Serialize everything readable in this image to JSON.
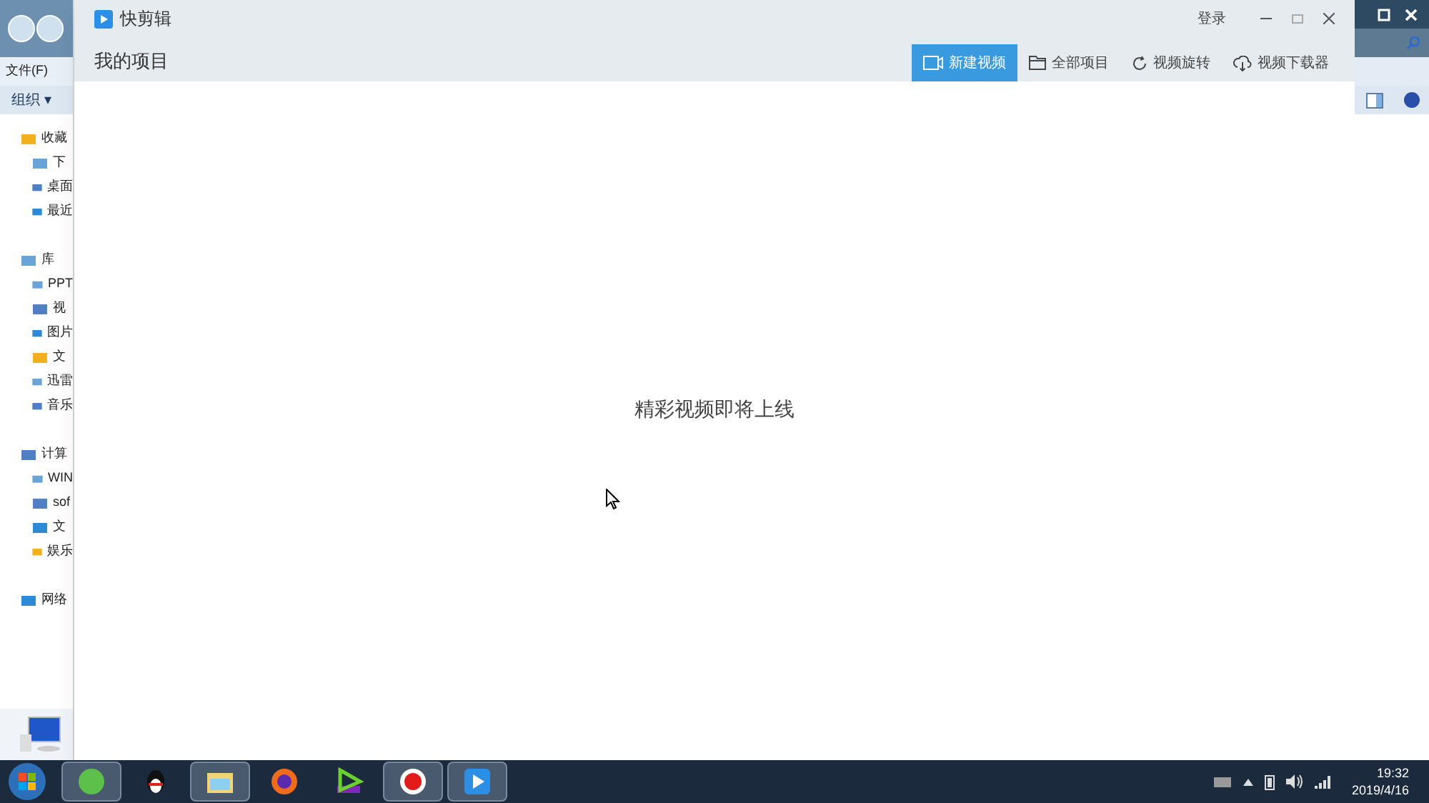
{
  "explorer": {
    "menu": "文件(F)",
    "toolbar": "组织 ▾",
    "tree": [
      {
        "label": "收藏",
        "children": [
          {
            "label": "下"
          },
          {
            "label": "桌面"
          },
          {
            "label": "最近"
          }
        ]
      },
      {
        "label": "库",
        "children": [
          {
            "label": "PPT"
          },
          {
            "label": "视"
          },
          {
            "label": "图片"
          },
          {
            "label": "文"
          },
          {
            "label": "迅雷"
          },
          {
            "label": "音乐"
          }
        ]
      },
      {
        "label": "计算",
        "children": [
          {
            "label": "WIN"
          },
          {
            "label": "sof"
          },
          {
            "label": "文"
          },
          {
            "label": "娱乐"
          }
        ]
      },
      {
        "label": "网络"
      }
    ]
  },
  "app": {
    "title": "快剪辑",
    "login": "登录",
    "heading": "我的项目",
    "actions": [
      {
        "label": "新建视频",
        "selected": true
      },
      {
        "label": "全部项目",
        "selected": false
      },
      {
        "label": "视频旋转",
        "selected": false
      },
      {
        "label": "视频下载器",
        "selected": false
      }
    ],
    "empty_message": "精彩视频即将上线"
  },
  "taskbar": {
    "apps": [
      {
        "active": true
      },
      {
        "active": false
      },
      {
        "active": true
      },
      {
        "active": false
      },
      {
        "active": false
      },
      {
        "active": true
      },
      {
        "active": true
      }
    ],
    "time": "19:32",
    "date": "2019/4/16"
  }
}
